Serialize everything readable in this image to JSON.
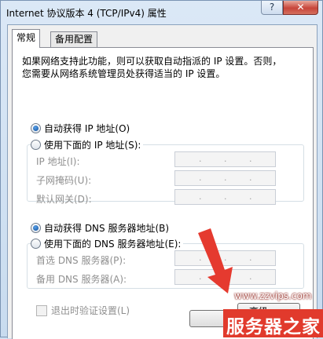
{
  "window": {
    "title": "Internet 协议版本 4 (TCP/IPv4) 属性",
    "help_glyph": "?",
    "close_glyph": "✕"
  },
  "tabs": [
    {
      "label": "常规",
      "active": true
    },
    {
      "label": "备用配置",
      "active": false
    }
  ],
  "description": [
    "如果网络支持此功能，则可以获取自动指派的 IP 设置。否则，",
    "您需要从网络系统管理员处获得适当的 IP 设置。"
  ],
  "ip_settings": {
    "auto_label": "自动获得 IP 地址(O)",
    "manual_label": "使用下面的 IP 地址(S):",
    "selected": "auto",
    "fields": [
      {
        "label": "IP 地址(I):",
        "value": ". . ."
      },
      {
        "label": "子网掩码(U):",
        "value": ". . ."
      },
      {
        "label": "默认网关(D):",
        "value": ". . ."
      }
    ]
  },
  "dns_settings": {
    "auto_label": "自动获得 DNS 服务器地址(B)",
    "manual_label": "使用下面的 DNS 服务器地址(E):",
    "selected": "auto",
    "fields": [
      {
        "label": "首选 DNS 服务器(P):",
        "value": ". . ."
      },
      {
        "label": "备用 DNS 服务器(A):",
        "value": ". . ."
      }
    ]
  },
  "validate_checkbox": {
    "label": "退出时验证设置(L)",
    "checked": false
  },
  "advanced_button": {
    "label": "高级"
  },
  "watermark": {
    "url": "www.zzvips.com",
    "brand": "服务器之家"
  },
  "colors": {
    "arrow": "#e53a2f",
    "watermark_bg": "#e13a2c"
  }
}
